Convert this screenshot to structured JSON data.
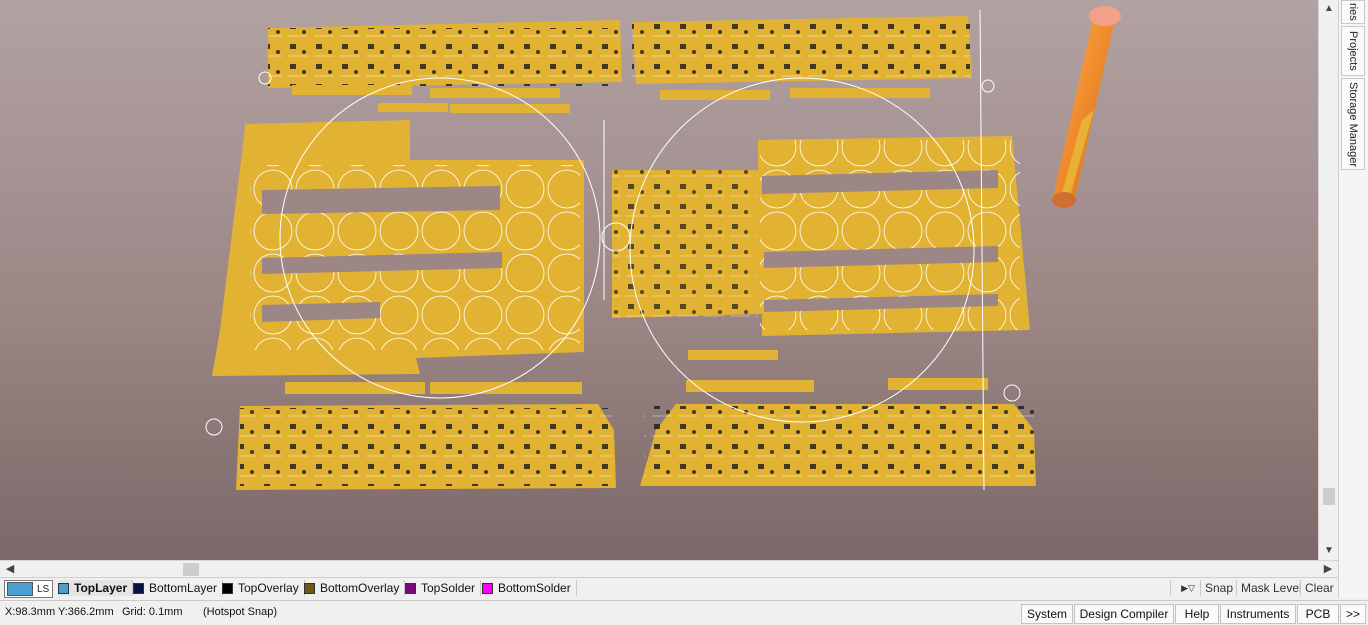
{
  "side_tabs": [
    "ries",
    "Projects",
    "Storage Manager"
  ],
  "layer_set_label": "LS",
  "layers": [
    {
      "label": "TopLayer",
      "color": "#4a9fd0"
    },
    {
      "label": "BottomLayer",
      "color": "#0a1240"
    },
    {
      "label": "TopOverlay",
      "color": "#000000"
    },
    {
      "label": "BottomOverlay",
      "color": "#6b5a10"
    },
    {
      "label": "TopSolder",
      "color": "#7a0a7a"
    },
    {
      "label": "BottomSolder",
      "color": "#ff00ff"
    }
  ],
  "layer_controls": {
    "snap": "Snap",
    "mask_level": "Mask Level",
    "clear": "Clear"
  },
  "status": {
    "coords": "X:98.3mm Y:366.2mm",
    "grid": "Grid: 0.1mm",
    "snap_mode": "(Hotspot Snap)",
    "buttons": [
      "System",
      "Design Compiler",
      "Help",
      "Instruments",
      "PCB",
      ">>"
    ]
  },
  "colors": {
    "copper": "#e2b233",
    "background": "#9c8686",
    "silkscreen": "#ffffff"
  }
}
